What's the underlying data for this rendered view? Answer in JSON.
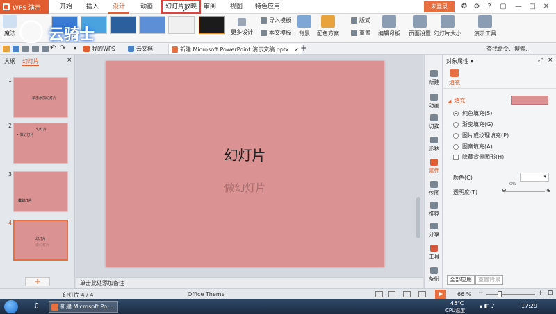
{
  "titlebar": {
    "app_name": "WPS 演示",
    "tabs": [
      {
        "label": "开始"
      },
      {
        "label": "插入"
      },
      {
        "label": "设计"
      },
      {
        "label": "动画"
      },
      {
        "label": "幻灯片放映"
      },
      {
        "label": "审阅"
      },
      {
        "label": "视图"
      },
      {
        "label": "特色应用"
      }
    ],
    "active_tab": "设计",
    "highlighted_tab": "幻灯片放映",
    "login_label": "未登录"
  },
  "ribbon": {
    "magic_label": "魔法",
    "more_design_label": "更多设计",
    "import_template_label": "导入模板",
    "text_template_label": "本文模板",
    "background_label": "背景",
    "color_scheme_label": "配色方案",
    "layout_label": "版式",
    "reset_label": "重置",
    "edit_master_label": "编辑母板",
    "page_setup_label": "页面设置",
    "slide_size_label": "幻灯片大小",
    "present_tools_label": "演示工具"
  },
  "doc_tabs": [
    {
      "label": "我的WPS"
    },
    {
      "label": "云文档"
    },
    {
      "label": "新建 Microsoft PowerPoint 演示文稿.pptx"
    }
  ],
  "search_cmd": "查找命令、搜索...",
  "left_panel": {
    "tab_outline": "大纲",
    "tab_slides": "幻灯片",
    "slides": [
      {
        "num": "1",
        "text": "单击添加幻灯片"
      },
      {
        "num": "2",
        "title": "幻灯片",
        "bullet": "• 做幻灯片"
      },
      {
        "num": "3",
        "text": "做幻灯片"
      },
      {
        "num": "4",
        "title": "幻灯片",
        "sub": "做幻灯片"
      }
    ],
    "add_label": "+"
  },
  "slide": {
    "title": "幻灯片",
    "subtitle": "做幻灯片"
  },
  "notes_placeholder": "单击此处添加备注",
  "side_strip": [
    {
      "label": "新建"
    },
    {
      "label": "动画"
    },
    {
      "label": "切换"
    },
    {
      "label": "形状"
    },
    {
      "label": "属性"
    },
    {
      "label": "传图"
    },
    {
      "label": "推荐"
    },
    {
      "label": "分享"
    },
    {
      "label": "工具"
    },
    {
      "label": "备份"
    }
  ],
  "properties": {
    "panel_title": "对象属性",
    "tab_fill": "填充",
    "section_fill": "填充",
    "options": [
      {
        "label": "纯色填充(S)",
        "selected": true
      },
      {
        "label": "渐变填充(G)",
        "selected": false
      },
      {
        "label": "图片或纹理填充(P)",
        "selected": false
      },
      {
        "label": "图案填充(A)",
        "selected": false
      }
    ],
    "hide_bg_label": "隐藏背景图形(H)",
    "color_label": "颜色(C)",
    "transparency_label": "透明度(T)",
    "transparency_value": "0%",
    "apply_all_label": "全部应用",
    "reset_bg_label": "重置背景",
    "fill_color": "#db9292"
  },
  "status": {
    "slide_info": "幻灯片 4 / 4",
    "theme": "Office Theme",
    "zoom": "66 %"
  },
  "taskbar": {
    "task_label": "新建 Microsoft Po...",
    "temp": "45℃",
    "cpu_label": "CPU温度",
    "time": "17:29"
  },
  "watermark_text": "云骑士",
  "colors": {
    "accent": "#e15d2f",
    "slide_bg": "#db9292"
  }
}
